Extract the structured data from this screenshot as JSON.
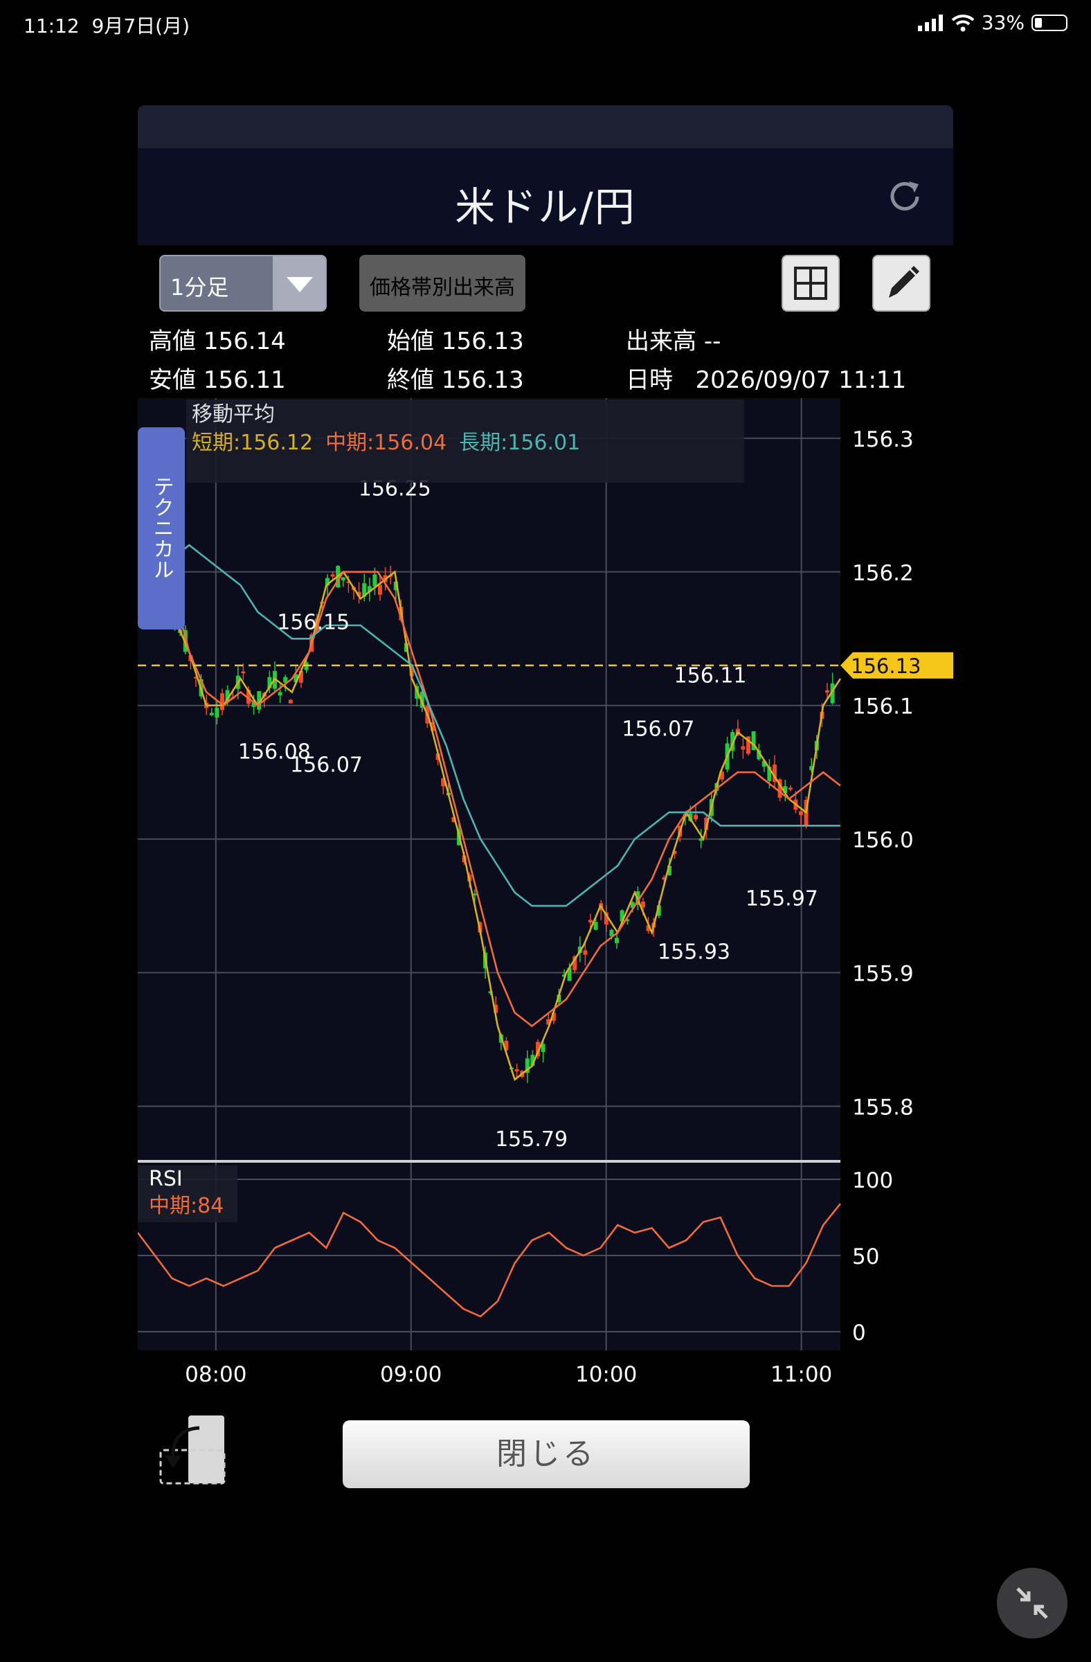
{
  "status_bar": {
    "time": "11:12",
    "date": "9月7日(月)",
    "battery": "33%"
  },
  "header": {
    "title": "米ドル/円"
  },
  "toolbar": {
    "timeframe": "1分足",
    "volume_profile_label": "価格帯別出来高"
  },
  "ohlc": {
    "high_label": "高値",
    "high": "156.14",
    "low_label": "安値",
    "low": "156.11",
    "open_label": "始値",
    "open": "156.13",
    "close_label": "終値",
    "close": "156.13",
    "volume_label": "出来高",
    "volume": "--",
    "datetime_label": "日時",
    "datetime": "2026/09/07 11:11"
  },
  "technical_tab": "テクニカル",
  "legend": {
    "title": "移動平均",
    "short": "短期:156.12",
    "mid": "中期:156.04",
    "long": "長期:156.01",
    "short_color": "#d6b21e",
    "mid_color": "#f26b3a",
    "long_color": "#4cb5b0"
  },
  "rsi_legend": {
    "title": "RSI",
    "mid": "中期:84"
  },
  "current_price_tag": "156.13",
  "chart_data": {
    "type": "line",
    "title": "米ドル/円",
    "x_tick_labels": [
      "08:00",
      "09:00",
      "10:00",
      "11:00"
    ],
    "y_tick_labels": [
      "156.3",
      "156.2",
      "156.1",
      "156.0",
      "155.9",
      "155.8"
    ],
    "ylim": [
      155.765,
      156.33
    ],
    "xlim": [
      "07:36",
      "11:12"
    ],
    "current_price": 156.13,
    "annotations": [
      {
        "time": "08:55",
        "value": "156.25"
      },
      {
        "time": "08:30",
        "value": "156.15"
      },
      {
        "time": "08:18",
        "value": "156.08"
      },
      {
        "time": "08:34",
        "value": "156.07"
      },
      {
        "time": "09:37",
        "value": "155.79"
      },
      {
        "time": "10:16",
        "value": "156.07"
      },
      {
        "time": "10:32",
        "value": "156.11"
      },
      {
        "time": "10:27",
        "value": "155.93"
      },
      {
        "time": "10:54",
        "value": "155.97"
      }
    ],
    "series": [
      {
        "name": "短期",
        "values": [
          156.23,
          156.21,
          156.17,
          156.14,
          156.1,
          156.1,
          156.12,
          156.1,
          156.12,
          156.11,
          156.14,
          156.19,
          156.2,
          156.18,
          156.19,
          156.2,
          156.12,
          156.09,
          156.04,
          155.99,
          155.93,
          155.86,
          155.82,
          155.83,
          155.86,
          155.9,
          155.92,
          155.95,
          155.93,
          155.96,
          155.93,
          155.98,
          156.02,
          156.0,
          156.05,
          156.08,
          156.07,
          156.05,
          156.03,
          156.02,
          156.1,
          156.12
        ]
      },
      {
        "name": "中期",
        "values": [
          156.25,
          156.23,
          156.19,
          156.14,
          156.11,
          156.1,
          156.11,
          156.1,
          156.11,
          156.12,
          156.14,
          156.18,
          156.2,
          156.2,
          156.2,
          156.18,
          156.14,
          156.1,
          156.05,
          156.0,
          155.95,
          155.9,
          155.87,
          155.86,
          155.87,
          155.88,
          155.9,
          155.92,
          155.93,
          155.95,
          155.97,
          156.0,
          156.02,
          156.03,
          156.04,
          156.05,
          156.05,
          156.04,
          156.03,
          156.04,
          156.05,
          156.04
        ]
      },
      {
        "name": "長期",
        "values": [
          156.17,
          156.2,
          156.21,
          156.22,
          156.21,
          156.2,
          156.19,
          156.17,
          156.16,
          156.15,
          156.15,
          156.16,
          156.16,
          156.16,
          156.15,
          156.14,
          156.13,
          156.1,
          156.07,
          156.03,
          156.0,
          155.98,
          155.96,
          155.95,
          155.95,
          155.95,
          155.96,
          155.97,
          155.98,
          156.0,
          156.01,
          156.02,
          156.02,
          156.02,
          156.01,
          156.01,
          156.01,
          156.01,
          156.01,
          156.01,
          156.01,
          156.01
        ]
      }
    ],
    "rsi": {
      "name": "中期",
      "ylim": [
        0,
        100
      ],
      "y_tick_labels": [
        "100",
        "50",
        "0"
      ],
      "values": [
        65,
        50,
        35,
        30,
        35,
        30,
        35,
        40,
        55,
        60,
        65,
        55,
        78,
        72,
        60,
        55,
        45,
        35,
        25,
        15,
        10,
        20,
        45,
        60,
        65,
        55,
        50,
        55,
        70,
        65,
        68,
        55,
        60,
        72,
        75,
        50,
        35,
        30,
        30,
        45,
        70,
        84
      ]
    }
  }
}
